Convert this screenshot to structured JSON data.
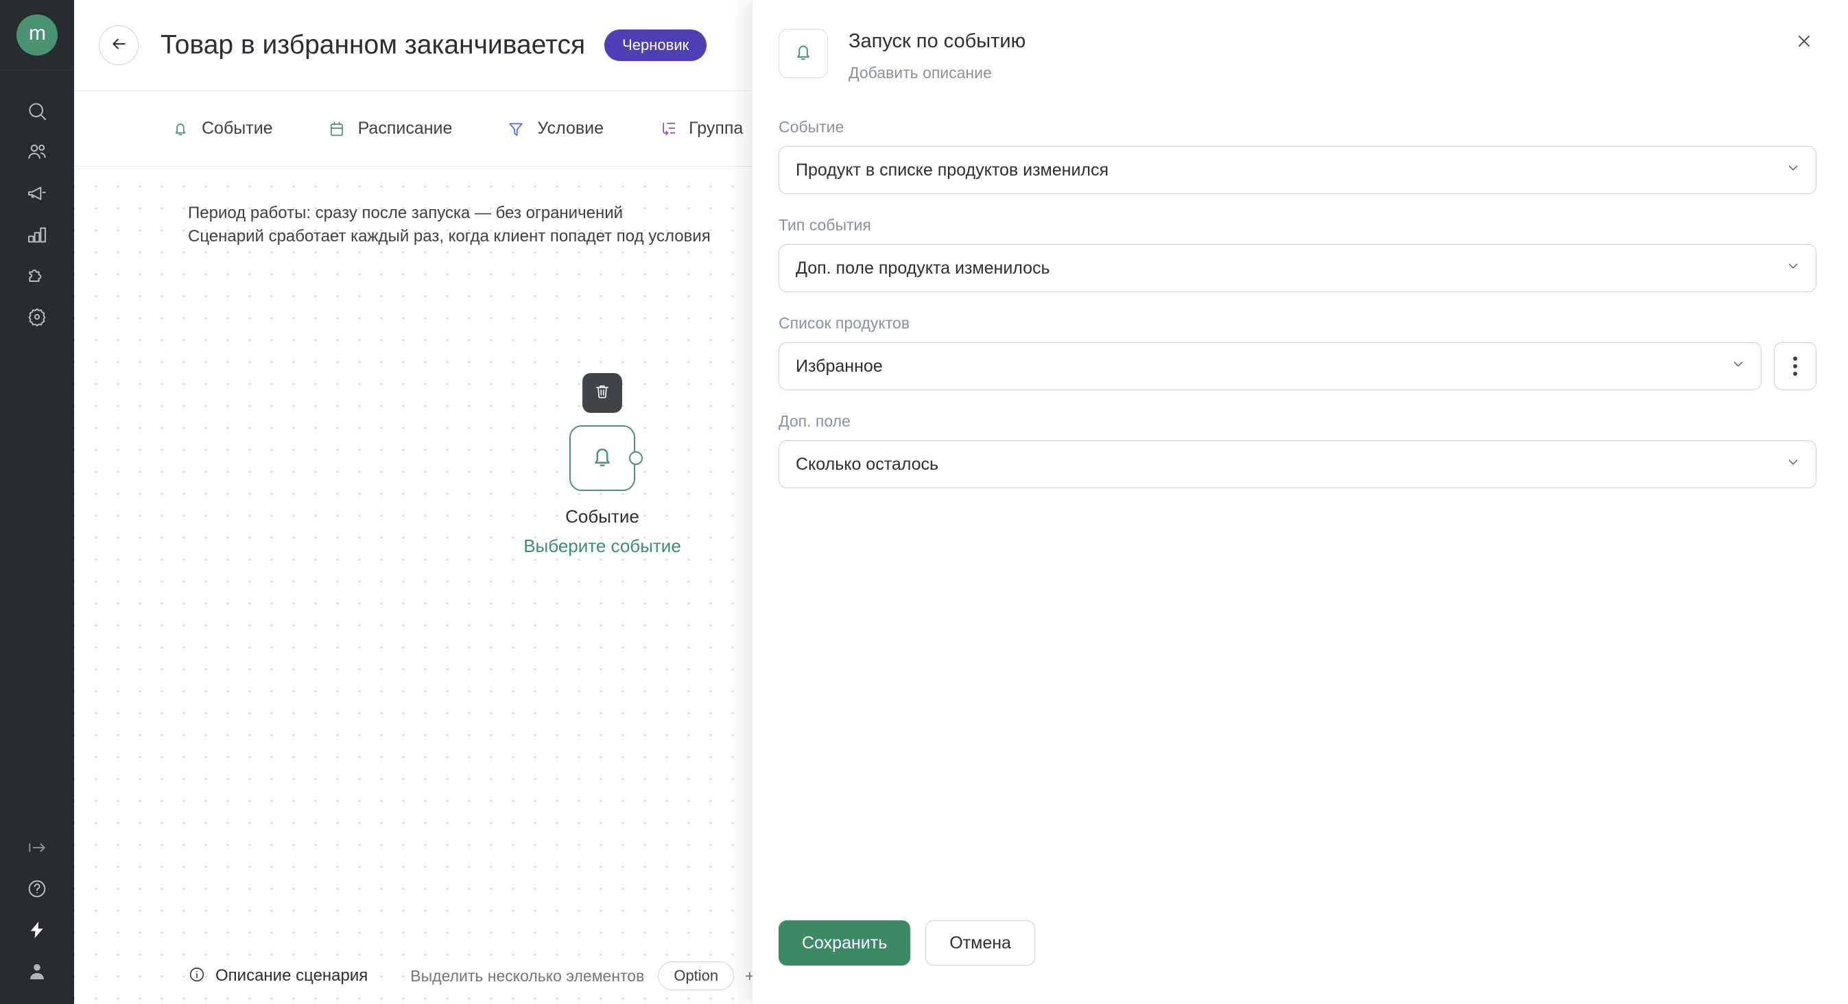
{
  "sidebar": {
    "logo_text": "m",
    "top_items": [
      {
        "name": "search-icon",
        "label": "Поиск"
      },
      {
        "name": "users-icon",
        "label": "Клиенты"
      },
      {
        "name": "megaphone-icon",
        "label": "Кампании"
      },
      {
        "name": "bar-chart-icon",
        "label": "Аналитика"
      },
      {
        "name": "puzzle-icon",
        "label": "Интеграции"
      },
      {
        "name": "gear-icon",
        "label": "Настройки"
      }
    ],
    "bottom_items": [
      {
        "name": "logout-icon",
        "label": "Выход"
      },
      {
        "name": "help-icon",
        "label": "Помощь"
      },
      {
        "name": "lightning-icon",
        "label": "Сценарии"
      },
      {
        "name": "account-icon",
        "label": "Профиль"
      }
    ]
  },
  "topbar": {
    "back_label": "Назад",
    "title": "Товар в избранном заканчивается",
    "status": "Черновик"
  },
  "tabs": [
    {
      "label": "Событие",
      "icon": "bell-icon",
      "color": "#4a9272"
    },
    {
      "label": "Расписание",
      "icon": "calendar-icon",
      "color": "#4a9272"
    },
    {
      "label": "Условие",
      "icon": "filter-icon",
      "color": "#4a6df0"
    },
    {
      "label": "Группа",
      "icon": "group-icon",
      "color": "#8e4fc4"
    }
  ],
  "canvas": {
    "note_line1": "Период работы: сразу после запуска — без ограничений",
    "note_line2": "Сценарий сработает каждый раз, когда клиент попадет под условия",
    "node": {
      "delete_label": "Удалить",
      "icon": "bell-icon",
      "title": "Событие",
      "link": "Выберите событие"
    },
    "footer": {
      "description": "Описание сценария",
      "hint": "Выделить несколько элементов",
      "kbd": "Option",
      "plus": "+"
    }
  },
  "panel": {
    "icon": "bell-icon",
    "title": "Запуск по событию",
    "subtitle": "Добавить описание",
    "close_label": "Закрыть",
    "fields": [
      {
        "label": "Событие",
        "value": "Продукт в списке продуктов изменился",
        "kebab": false
      },
      {
        "label": "Тип события",
        "value": "Доп. поле продукта изменилось",
        "kebab": false
      },
      {
        "label": "Список продуктов",
        "value": "Избранное",
        "kebab": true
      },
      {
        "label": "Доп. поле",
        "value": "Сколько осталось",
        "kebab": false
      }
    ],
    "save_label": "Сохранить",
    "cancel_label": "Отмена"
  },
  "colors": {
    "brand_green": "#4a9272",
    "save_green": "#3c8a66",
    "badge_purple": "#4f3fb5",
    "sidebar_dark": "#282c30",
    "border": "#c6d2da",
    "muted_text": "#8a929b"
  }
}
